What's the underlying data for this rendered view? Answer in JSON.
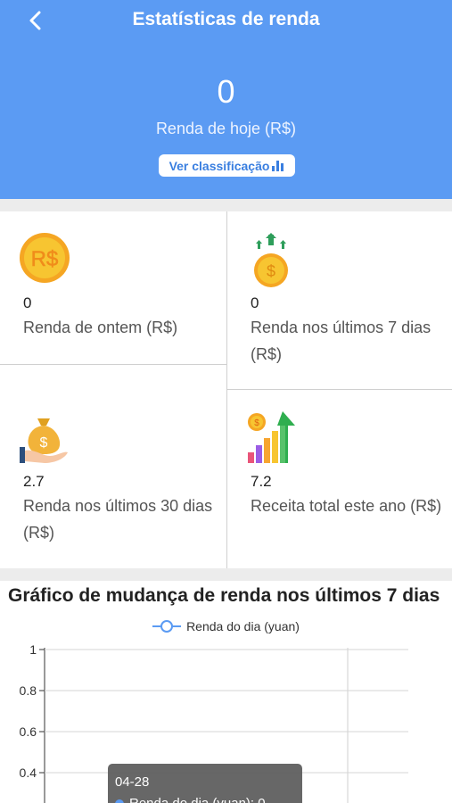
{
  "header": {
    "title": "Estatísticas de renda",
    "today_value": "0",
    "today_label": "Renda de hoje (R$)",
    "rank_button": "Ver classificação"
  },
  "stats": [
    {
      "icon": "coin-rs-icon",
      "value": "0",
      "label": "Renda de ontem (R$)"
    },
    {
      "icon": "coin-arrows-up-icon",
      "value": "0",
      "label": "Renda nos últimos 7 dias (R$)"
    },
    {
      "icon": "money-bag-hand-icon",
      "value": "2.7",
      "label": "Renda nos últimos 30 dias (R$)"
    },
    {
      "icon": "growth-bar-chart-icon",
      "value": "7.2",
      "label": "Receita total este ano (R$)"
    }
  ],
  "chart": {
    "title": "Gráfico de mudança de renda nos últimos 7 dias",
    "legend": "Renda do dia (yuan)",
    "tooltip_date": "04-28",
    "tooltip_series": "Renda do dia (yuan): 0"
  },
  "chart_data": {
    "type": "line",
    "title": "Gráfico de mudança de renda nos últimos 7 dias",
    "series": [
      {
        "name": "Renda do dia (yuan)",
        "values": []
      }
    ],
    "y_ticks": [
      "1",
      "0.8",
      "0.6",
      "0.4"
    ],
    "ylim": [
      0,
      1
    ],
    "grid": true,
    "legend_position": "top-center"
  },
  "colors": {
    "header": "#5b9bf3",
    "accent": "#3a7fe0",
    "coin": "#f7c531"
  }
}
